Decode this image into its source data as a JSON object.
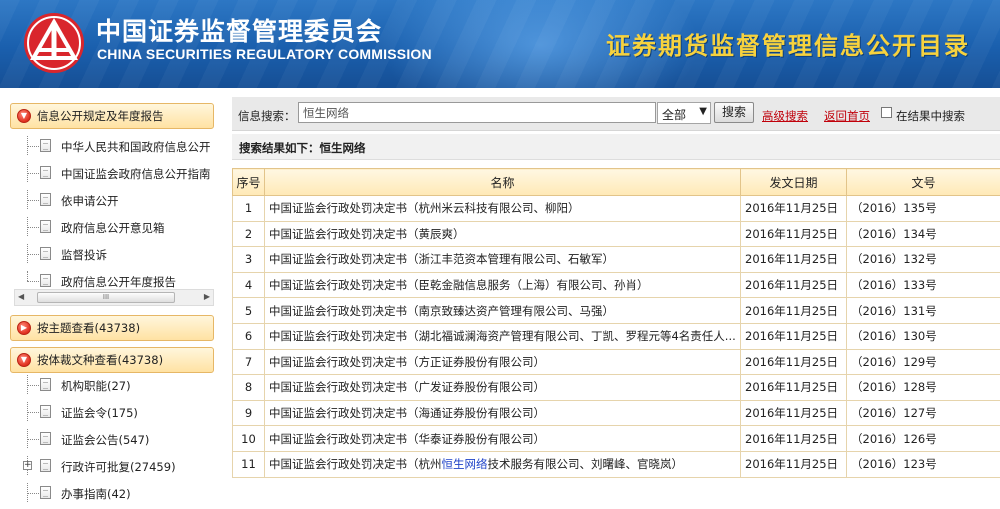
{
  "header": {
    "org_name_cn": "中国证券监督管理委员会",
    "org_name_en": "CHINA SECURITIES REGULATORY COMMISSION",
    "site_title": "证券期货监督管理信息公开目录"
  },
  "sidebar": {
    "panel1": {
      "title": "信息公开规定及年度报告",
      "items": [
        {
          "label": "中华人民共和国政府信息公开"
        },
        {
          "label": "中国证监会政府信息公开指南"
        },
        {
          "label": "依申请公开"
        },
        {
          "label": "政府信息公开意见箱"
        },
        {
          "label": "监督投诉"
        },
        {
          "label": "政府信息公开年度报告"
        }
      ],
      "scroll_thumb": "III"
    },
    "panel2": {
      "title": "按主题查看(43738)"
    },
    "panel3": {
      "title": "按体裁文种查看(43738)",
      "items": [
        {
          "label": "机构职能(27)"
        },
        {
          "label": "证监会令(175)"
        },
        {
          "label": "证监会公告(547)"
        },
        {
          "label": "行政许可批复(27459)"
        },
        {
          "label": "办事指南(42)"
        }
      ]
    }
  },
  "search": {
    "label": "信息搜索：",
    "value": "恒生网络",
    "scope": "全部",
    "button": "搜索",
    "advanced_link": "高级搜索",
    "home_link": "返回首页",
    "within_results_label": "在结果中搜索"
  },
  "result_heading": "搜索结果如下：恒生网络",
  "table": {
    "headers": {
      "no": "序号",
      "name": "名称",
      "date": "发文日期",
      "doc": "文号"
    },
    "rows": [
      {
        "no": "1",
        "name": "中国证监会行政处罚决定书（杭州米云科技有限公司、柳阳）",
        "date": "2016年11月25日",
        "doc": "（2016）135号"
      },
      {
        "no": "2",
        "name": "中国证监会行政处罚决定书（黄辰爽）",
        "date": "2016年11月25日",
        "doc": "（2016）134号"
      },
      {
        "no": "3",
        "name": "中国证监会行政处罚决定书（浙江丰范资本管理有限公司、石敏军）",
        "date": "2016年11月25日",
        "doc": "（2016）132号"
      },
      {
        "no": "4",
        "name": "中国证监会行政处罚决定书（臣乾金融信息服务（上海）有限公司、孙肖）",
        "date": "2016年11月25日",
        "doc": "（2016）133号"
      },
      {
        "no": "5",
        "name": "中国证监会行政处罚决定书（南京致臻达资产管理有限公司、马强）",
        "date": "2016年11月25日",
        "doc": "（2016）131号"
      },
      {
        "no": "6",
        "name": "中国证监会行政处罚决定书（湖北福诚澜海资产管理有限公司、丁凯、罗程元等4名责任人...",
        "date": "2016年11月25日",
        "doc": "（2016）130号"
      },
      {
        "no": "7",
        "name": "中国证监会行政处罚决定书（方正证券股份有限公司）",
        "date": "2016年11月25日",
        "doc": "（2016）129号"
      },
      {
        "no": "8",
        "name": "中国证监会行政处罚决定书（广发证券股份有限公司）",
        "date": "2016年11月25日",
        "doc": "（2016）128号"
      },
      {
        "no": "9",
        "name": "中国证监会行政处罚决定书（海通证券股份有限公司）",
        "date": "2016年11月25日",
        "doc": "（2016）127号"
      },
      {
        "no": "10",
        "name": "中国证监会行政处罚决定书（华泰证券股份有限公司）",
        "date": "2016年11月25日",
        "doc": "（2016）126号"
      },
      {
        "no": "11",
        "name_pre": "中国证监会行政处罚决定书（杭州",
        "name_hl": "恒生网络",
        "name_post": "技术服务有限公司、刘曙峰、官晓岚）",
        "date": "2016年11月25日",
        "doc": "（2016）123号"
      }
    ]
  }
}
